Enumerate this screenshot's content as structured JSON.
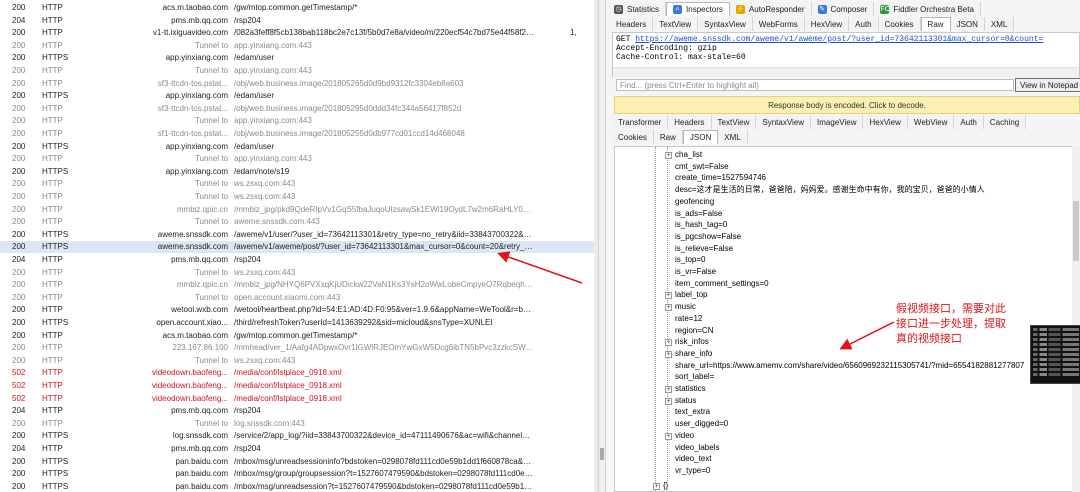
{
  "sessions": [
    {
      "result": "200",
      "protocol": "HTTP",
      "host": "acs.m.taobao.com",
      "url": "/gw/mtop.common.getTimestamp/*",
      "kind": "normal",
      "extra": ""
    },
    {
      "result": "204",
      "protocol": "HTTP",
      "host": "pms.mb.qq.com",
      "url": "/rsp204",
      "kind": "normal",
      "extra": ""
    },
    {
      "result": "200",
      "protocol": "HTTP",
      "host": "v1-tt.ixiguavideo.com",
      "url": "/082a3feff8f5cb138bab118bc2e7c13f/5b0d7e8a/video/m/220ecf54c7bd75e44f58f24f83a9...",
      "kind": "normal",
      "extra": "1,"
    },
    {
      "result": "200",
      "protocol": "HTTP",
      "host": "Tunnel to",
      "url": "app.yinxiang.com:443",
      "kind": "tunnel",
      "extra": ""
    },
    {
      "result": "200",
      "protocol": "HTTPS",
      "host": "app.yinxiang.com",
      "url": "/edam/user",
      "kind": "normal",
      "extra": ""
    },
    {
      "result": "200",
      "protocol": "HTTP",
      "host": "Tunnel to",
      "url": "app.yinxiang.com:443",
      "kind": "tunnel",
      "extra": ""
    },
    {
      "result": "200",
      "protocol": "HTTP",
      "host": "sf3-ttcdn-tos.pstat...",
      "url": "/obj/web.business.image/201805265d0d9bd9312fc3304eb8a603",
      "kind": "tunnel",
      "extra": ""
    },
    {
      "result": "200",
      "protocol": "HTTPS",
      "host": "app.yinxiang.com",
      "url": "/edam/user",
      "kind": "normal",
      "extra": ""
    },
    {
      "result": "200",
      "protocol": "HTTP",
      "host": "sf3-ttcdn-tos.pstat...",
      "url": "/obj/web.business.image/201805295d0ddd34fc344a56417f852d",
      "kind": "tunnel",
      "extra": ""
    },
    {
      "result": "200",
      "protocol": "HTTP",
      "host": "Tunnel to",
      "url": "app.yinxiang.com:443",
      "kind": "tunnel",
      "extra": ""
    },
    {
      "result": "200",
      "protocol": "HTTP",
      "host": "sf1-ttcdn-tos.pstat...",
      "url": "/obj/web.business.image/201805255d0db977cd01ccd14d468048",
      "kind": "tunnel",
      "extra": ""
    },
    {
      "result": "200",
      "protocol": "HTTPS",
      "host": "app.yinxiang.com",
      "url": "/edam/user",
      "kind": "normal",
      "extra": ""
    },
    {
      "result": "200",
      "protocol": "HTTP",
      "host": "Tunnel to",
      "url": "app.yinxiang.com:443",
      "kind": "tunnel",
      "extra": ""
    },
    {
      "result": "200",
      "protocol": "HTTPS",
      "host": "app.yinxiang.com",
      "url": "/edam/note/s19",
      "kind": "normal",
      "extra": ""
    },
    {
      "result": "200",
      "protocol": "HTTP",
      "host": "Tunnel to",
      "url": "ws.zsxq.com:443",
      "kind": "tunnel",
      "extra": ""
    },
    {
      "result": "200",
      "protocol": "HTTP",
      "host": "Tunnel to",
      "url": "ws.zsxq.com:443",
      "kind": "tunnel",
      "extra": ""
    },
    {
      "result": "200",
      "protocol": "HTTP",
      "host": "mmbiz.qpic.cn",
      "url": "/mmbiz_jpg/pkd9QdeRIpVv1GqS5fbaJuqoUIzsawSk1EWl19OydL7w2m6RaHLY0QnX7OVMhic...",
      "kind": "tunnel",
      "extra": ""
    },
    {
      "result": "200",
      "protocol": "HTTP",
      "host": "Tunnel to",
      "url": "aweme.snssdk.com:443",
      "kind": "tunnel",
      "extra": ""
    },
    {
      "result": "200",
      "protocol": "HTTPS",
      "host": "aweme.snssdk.com",
      "url": "/aweme/v1/user/?user_id=73642113301&retry_type=no_retry&iid=33843700322&device_...",
      "kind": "normal",
      "extra": ""
    },
    {
      "result": "200",
      "protocol": "HTTPS",
      "host": "aweme.snssdk.com",
      "url": "/aweme/v1/aweme/post/?user_id=73642113301&max_cursor=0&count=20&retry_type=n...",
      "kind": "selected",
      "extra": ""
    },
    {
      "result": "204",
      "protocol": "HTTP",
      "host": "pms.mb.qq.com",
      "url": "/rsp204",
      "kind": "normal",
      "extra": ""
    },
    {
      "result": "200",
      "protocol": "HTTP",
      "host": "Tunnel to",
      "url": "ws.zsxq.com:443",
      "kind": "tunnel",
      "extra": ""
    },
    {
      "result": "200",
      "protocol": "HTTP",
      "host": "mmbiz.qpic.cn",
      "url": "/mmbiz_jpg/NHYQ6PVXxqKjUDickw22VaN1Ks3YsH2oWwLobeCmpyeO7RqbeqhCcbNIoqQrNu...",
      "kind": "tunnel",
      "extra": ""
    },
    {
      "result": "200",
      "protocol": "HTTP",
      "host": "Tunnel to",
      "url": "open.account.xiaomi.com:443",
      "kind": "tunnel",
      "extra": ""
    },
    {
      "result": "200",
      "protocol": "HTTP",
      "host": "wetool.wxb.com",
      "url": "/wetool/heartbeat.php?id=54:E1:AD:4D:F0:95&ver=1.9.6&appName=WeTool&r=baP%2Fl...",
      "kind": "normal",
      "extra": ""
    },
    {
      "result": "200",
      "protocol": "HTTPS",
      "host": "open.account.xiao...",
      "url": "/third/refreshToken?userId=1413639292&sid=micloud&snsType=XUNLEI",
      "kind": "normal",
      "extra": ""
    },
    {
      "result": "200",
      "protocol": "HTTP",
      "host": "acs.m.taobao.com",
      "url": "/gw/mtop.common.getTimestamp/*",
      "kind": "normal",
      "extra": ""
    },
    {
      "result": "200",
      "protocol": "HTTP",
      "host": "223.167.86.100",
      "url": "/mmhead/ver_1/Aafg4ADpwxOvr1IGWlRJEOmYwGxW5Dcg6ibTN5bPvc3zzkcSW8mI2gXUNH...",
      "kind": "tunnel",
      "extra": ""
    },
    {
      "result": "200",
      "protocol": "HTTP",
      "host": "Tunnel to",
      "url": "ws.zsxq.com:443",
      "kind": "tunnel",
      "extra": ""
    },
    {
      "result": "502",
      "protocol": "HTTP",
      "host": "videodown.baofeng...",
      "url": "/media/conf/lstplace_0918.xml",
      "kind": "error",
      "extra": ""
    },
    {
      "result": "502",
      "protocol": "HTTP",
      "host": "videodown.baofeng...",
      "url": "/media/conf/lstplace_0918.xml",
      "kind": "error",
      "extra": ""
    },
    {
      "result": "502",
      "protocol": "HTTP",
      "host": "videodown.baofeng...",
      "url": "/media/conf/lstplace_0918.xml",
      "kind": "error",
      "extra": ""
    },
    {
      "result": "204",
      "protocol": "HTTP",
      "host": "pms.mb.qq.com",
      "url": "/rsp204",
      "kind": "normal",
      "extra": ""
    },
    {
      "result": "200",
      "protocol": "HTTP",
      "host": "Tunnel to",
      "url": "log.snssdk.com:443",
      "kind": "tunnel",
      "extra": ""
    },
    {
      "result": "200",
      "protocol": "HTTPS",
      "host": "log.snssdk.com",
      "url": "/service/2/app_log/?iid=33843700322&device_id=47111490676&ac=wifi&channel=xiaomi&...",
      "kind": "normal",
      "extra": ""
    },
    {
      "result": "204",
      "protocol": "HTTP",
      "host": "pms.mb.qq.com",
      "url": "/rsp204",
      "kind": "normal",
      "extra": ""
    },
    {
      "result": "200",
      "protocol": "HTTPS",
      "host": "pan.baidu.com",
      "url": "/mbox/msg/unreadsessioninfo?bdstoken=0298078fd111cd0e59b1dd1f660878ca&channel=...",
      "kind": "normal",
      "extra": ""
    },
    {
      "result": "200",
      "protocol": "HTTPS",
      "host": "pan.baidu.com",
      "url": "/mbox/msg/group/groupsession?t=1527607479590&bdstoken=0298078fd111cd0e59b1dd1f660...",
      "kind": "normal",
      "extra": ""
    },
    {
      "result": "200",
      "protocol": "HTTPS",
      "host": "pan.baidu.com",
      "url": "/mbox/msg/unreadsession?t=1527607479590&bdstoken=0298078fd111cd0e59b1dd1f660...",
      "kind": "normal",
      "extra": ""
    }
  ],
  "top_tabs": [
    {
      "label": "Statistics",
      "icon": "clock-icon",
      "active": false
    },
    {
      "label": "Inspectors",
      "icon": "magnifier-icon",
      "active": true
    },
    {
      "label": "AutoResponder",
      "icon": "lightning-icon",
      "active": false
    },
    {
      "label": "Composer",
      "icon": "pencil-icon",
      "active": false
    },
    {
      "label": "Fiddler Orchestra Beta",
      "icon": "fo-badge-icon",
      "active": false
    }
  ],
  "request_tabs": [
    {
      "label": "Headers",
      "active": false
    },
    {
      "label": "TextView",
      "active": false
    },
    {
      "label": "SyntaxView",
      "active": false
    },
    {
      "label": "WebForms",
      "active": false
    },
    {
      "label": "HexView",
      "active": false
    },
    {
      "label": "Auth",
      "active": false
    },
    {
      "label": "Cookies",
      "active": false
    },
    {
      "label": "Raw",
      "active": true
    },
    {
      "label": "JSON",
      "active": false
    },
    {
      "label": "XML",
      "active": false
    }
  ],
  "raw_request": {
    "method": "GET ",
    "url": "https://aweme.snssdk.com/aweme/v1/aweme/post/?user_id=73642113301&max_cursor=0&count=",
    "lines": [
      "Accept-Encoding: gzip",
      "Cache-Control: max-stale=60"
    ]
  },
  "find_placeholder": "Find... (press Ctrl+Enter to highlight all)",
  "view_notepad_label": "View in Notepad",
  "encoded_notice": "Response body is encoded. Click to decode.",
  "response_tabs_row1": [
    {
      "label": "Transformer",
      "active": false
    },
    {
      "label": "Headers",
      "active": false
    },
    {
      "label": "TextView",
      "active": false
    },
    {
      "label": "SyntaxView",
      "active": false
    },
    {
      "label": "ImageView",
      "active": false
    },
    {
      "label": "HexView",
      "active": false
    },
    {
      "label": "WebView",
      "active": false
    },
    {
      "label": "Auth",
      "active": false
    },
    {
      "label": "Caching",
      "active": false
    }
  ],
  "response_tabs_row2": [
    {
      "label": "Cookies",
      "active": false
    },
    {
      "label": "Raw",
      "active": false
    },
    {
      "label": "JSON",
      "active": true
    },
    {
      "label": "XML",
      "active": false
    }
  ],
  "json_tree": [
    {
      "text": "cha_list",
      "expandable": true
    },
    {
      "text": "cmt_swt=False",
      "expandable": false
    },
    {
      "text": "create_time=1527594746",
      "expandable": false
    },
    {
      "text": "desc=这才是生活的日常，爸爸陪，妈妈爱。感谢生命中有你，我的宝贝，爸爸的小情人",
      "expandable": false
    },
    {
      "text": "geofencing",
      "expandable": false
    },
    {
      "text": "is_ads=False",
      "expandable": false
    },
    {
      "text": "is_hash_tag=0",
      "expandable": false
    },
    {
      "text": "is_pgcshow=False",
      "expandable": false
    },
    {
      "text": "is_relieve=False",
      "expandable": false
    },
    {
      "text": "is_top=0",
      "expandable": false
    },
    {
      "text": "is_vr=False",
      "expandable": false
    },
    {
      "text": "item_comment_settings=0",
      "expandable": false
    },
    {
      "text": "label_top",
      "expandable": true
    },
    {
      "text": "music",
      "expandable": true
    },
    {
      "text": "rate=12",
      "expandable": false
    },
    {
      "text": "region=CN",
      "expandable": false
    },
    {
      "text": "risk_infos",
      "expandable": true
    },
    {
      "text": "share_info",
      "expandable": true
    },
    {
      "text": "share_url=https://www.amemv.com/share/video/6560969232115305741/?mid=6554182881277807",
      "expandable": false
    },
    {
      "text": "sort_label=",
      "expandable": false
    },
    {
      "text": "statistics",
      "expandable": true
    },
    {
      "text": "status",
      "expandable": true
    },
    {
      "text": "text_extra",
      "expandable": false
    },
    {
      "text": "user_digged=0",
      "expandable": false
    },
    {
      "text": "video",
      "expandable": true
    },
    {
      "text": "video_labels",
      "expandable": false
    },
    {
      "text": "video_text",
      "expandable": false
    },
    {
      "text": "vr_type=0",
      "expandable": false
    }
  ],
  "tree_footer": "{}",
  "annotation": "假视频接口，需要对此接口进一步处理，提取真的视频接口",
  "colors": {
    "annotation": "#e0141c",
    "error_row": "#d4141d",
    "selected_row": "#dbe7f5",
    "notice_bg": "#fcefb3"
  }
}
